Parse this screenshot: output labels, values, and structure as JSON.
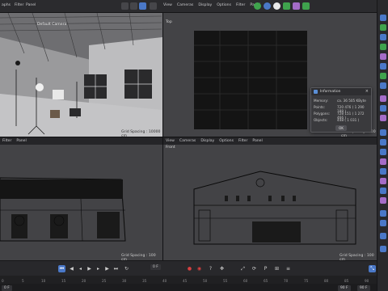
{
  "top_menu": {
    "perspective_items": [
      "aphs",
      "Filter",
      "Panel"
    ]
  },
  "viewports": {
    "perspective": {
      "label": "Default Camera",
      "grid_spacing": "Grid Spacing : 10000 cm"
    },
    "top": {
      "menu": [
        "View",
        "Cameras",
        "Display",
        "Options",
        "Filter",
        "Panel"
      ],
      "label": "Top",
      "grid_spacing": "Grid Spacing : 100 cm"
    },
    "right": {
      "menu": [
        "View",
        "Cameras",
        "Display",
        "Options",
        "Filter",
        "Panel"
      ],
      "label": "",
      "grid_spacing": "Grid Spacing : 100 cm"
    },
    "front": {
      "menu": [
        "View",
        "Cameras",
        "Display",
        "Options",
        "Filter",
        "Panel"
      ],
      "label": "Front",
      "grid_spacing": "Grid Spacing : 100 cm"
    },
    "left_menu_partial": [
      "Filter",
      "Panel"
    ]
  },
  "info_dialog": {
    "title": "Information",
    "rows": [
      {
        "label": "Memory:",
        "value": "ca. 36 505 KByte"
      },
      {
        "label": "Points:",
        "value": "720 476 ( 1 290 188 )"
      },
      {
        "label": "Polygons:",
        "value": "728 151 ( 1 272 466 )"
      },
      {
        "label": "Objects:",
        "value": "448 ( 1 031 )"
      }
    ],
    "ok_label": "OK"
  },
  "timeline": {
    "current_frame": "0 F",
    "ticks": [
      "0",
      "5",
      "10",
      "15",
      "20",
      "25",
      "30",
      "35",
      "40",
      "45",
      "50",
      "55",
      "60",
      "65",
      "70",
      "75",
      "80",
      "85",
      "90"
    ],
    "start_frame": "0 F",
    "end_frame_a": "90 F",
    "end_frame_b": "90 F"
  },
  "colors": {
    "accent_blue": "#4a78c8",
    "record_red": "#d94040",
    "viewport_bg": "#434346",
    "wireframe": "#0a0a0a"
  }
}
